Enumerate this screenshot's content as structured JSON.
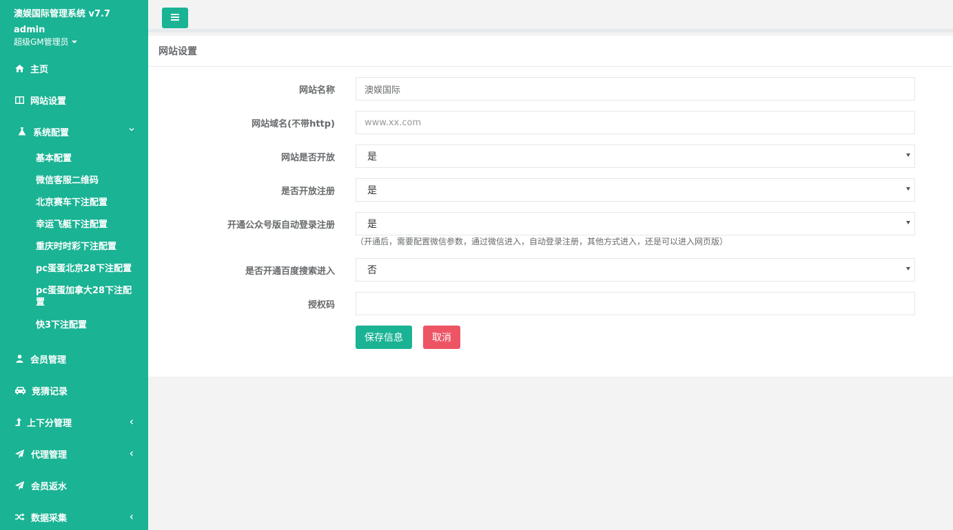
{
  "sidebar": {
    "app_title": "澳娱国际管理系统 v7.7",
    "username": "admin",
    "role": "超级GM管理员",
    "nav": {
      "home": "主页",
      "site_settings": "网站设置",
      "system_config": "系统配置",
      "members": "会员管理",
      "bets": "竞猜记录",
      "points": "上下分管理",
      "agents": "代理管理",
      "rebate": "会员返水",
      "data_collect": "数据采集"
    },
    "sub": {
      "basic": "基本配置",
      "wechat_qr": "微信客服二维码",
      "beijing_pk": "北京赛车下注配置",
      "lucky_boat": "幸运飞艇下注配置",
      "chongqing": "重庆时时彩下注配置",
      "pc_beijing": "pc蛋蛋北京28下注配置",
      "pc_canada": "pc蛋蛋加拿大28下注配置",
      "k3": "快3下注配置"
    }
  },
  "panel": {
    "title": "网站设置"
  },
  "form": {
    "site_name_label": "网站名称",
    "site_name_value": "澳娱国际",
    "domain_label": "网站域名(不带http)",
    "domain_placeholder": "www.xx.com",
    "site_open_label": "网站是否开放",
    "site_open_value": "是",
    "register_open_label": "是否开放注册",
    "register_open_value": "是",
    "wechat_auto_label": "开通公众号版自动登录注册",
    "wechat_auto_value": "是",
    "wechat_auto_help": "（开通后，需要配置微信参数，通过微信进入，自动登录注册，其他方式进入，还是可以进入网页版）",
    "baidu_label": "是否开通百度搜索进入",
    "baidu_value": "否",
    "auth_code_label": "授权码",
    "auth_code_value": "",
    "save_label": "保存信息",
    "cancel_label": "取消"
  }
}
